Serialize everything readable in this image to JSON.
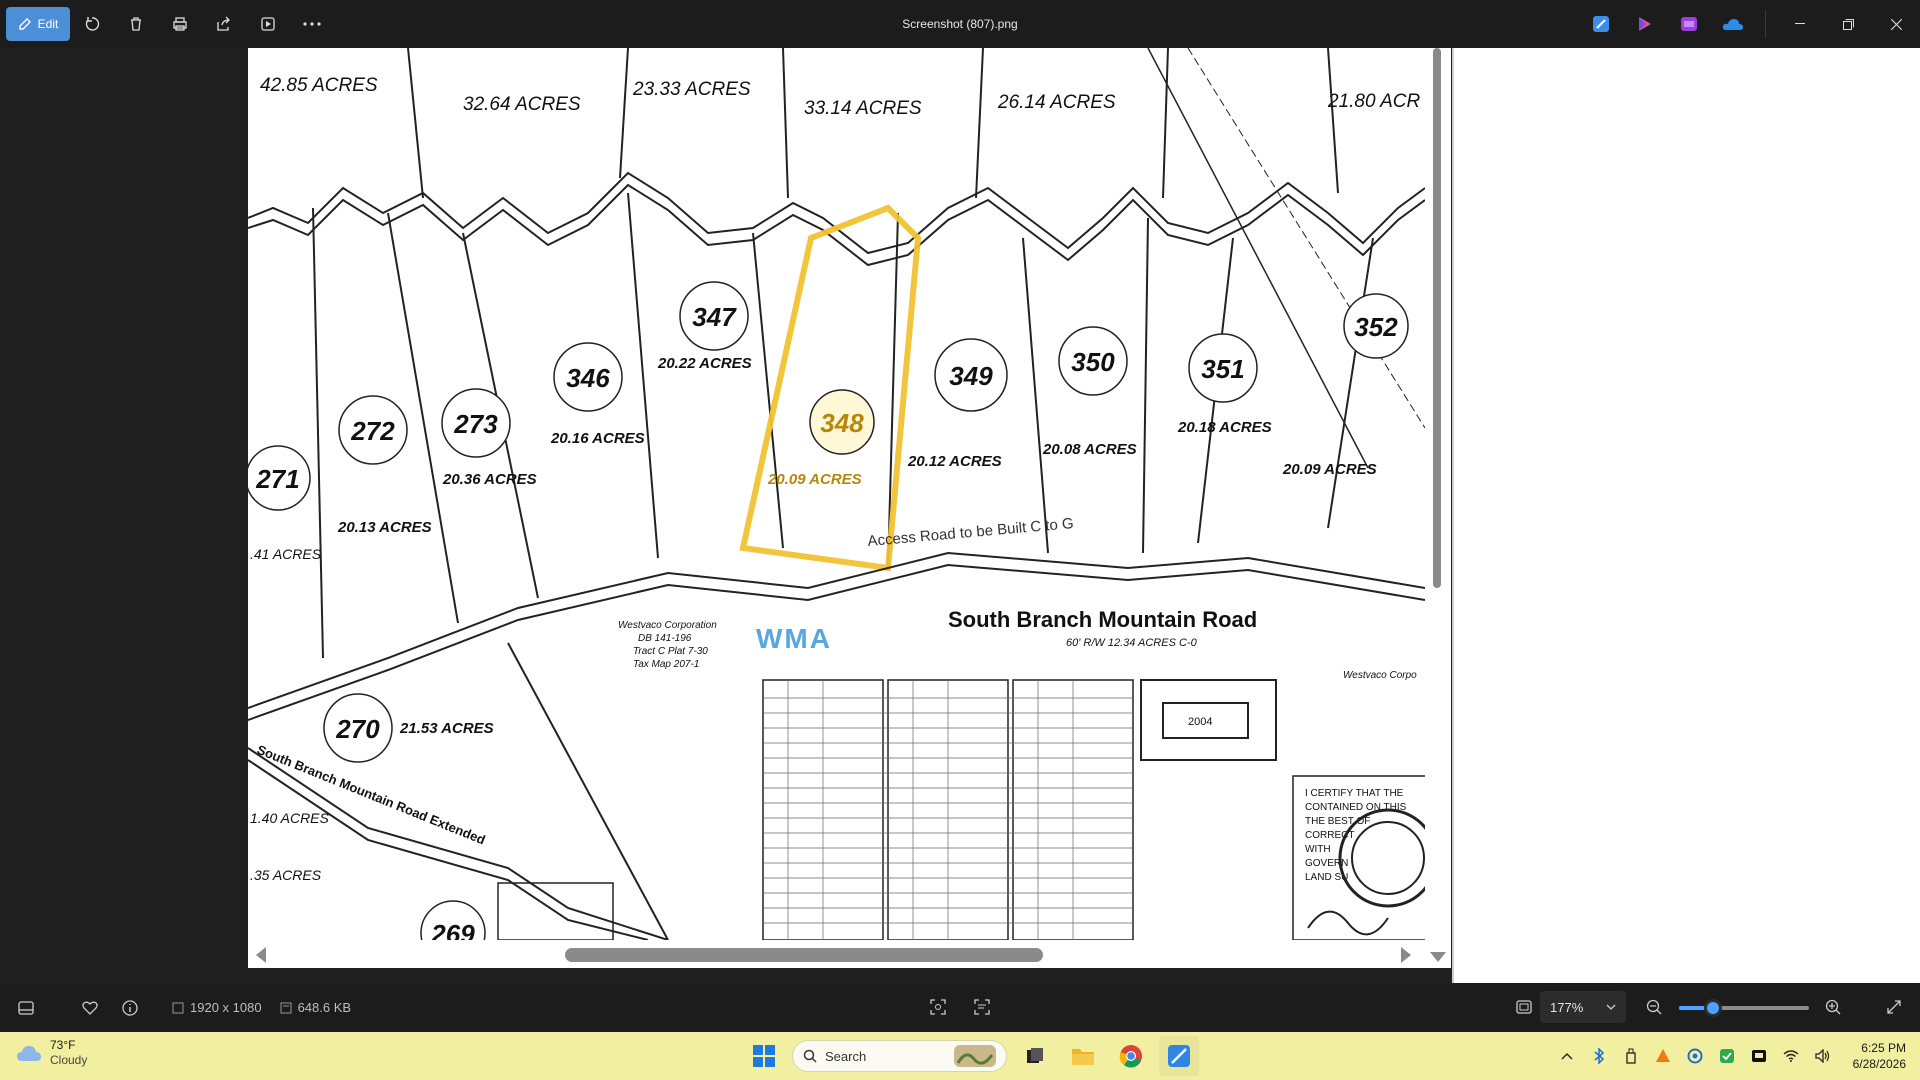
{
  "titlebar": {
    "edit_label": "Edit",
    "file_name": "Screenshot (807).png"
  },
  "map": {
    "parcels": [
      {
        "id": "347",
        "acres": "20.22 ACRES"
      },
      {
        "id": "346",
        "acres": "20.16 ACRES"
      },
      {
        "id": "272",
        "acres": ""
      },
      {
        "id": "273",
        "acres": "20.36 ACRES"
      },
      {
        "id": "271",
        "acres": "20.13 ACRES"
      },
      {
        "id": "348",
        "acres": "20.09 ACRES"
      },
      {
        "id": "349",
        "acres": "20.12 ACRES"
      },
      {
        "id": "350",
        "acres": "20.08 ACRES"
      },
      {
        "id": "351",
        "acres": "20.18 ACRES"
      },
      {
        "id": "352",
        "acres": "20.09 ACRES"
      },
      {
        "id": "270",
        "acres": "21.53 ACRES"
      },
      {
        "id": "269",
        "acres": ""
      }
    ],
    "top_acres": [
      "42.85 ACRES",
      "32.64 ACRES",
      "23.33 ACRES",
      "33.14 ACRES",
      "26.14 ACRES",
      "21.80 ACR"
    ],
    "left_acres": [
      ".41 ACRES",
      "1.40 ACRES",
      ".35 ACRES"
    ],
    "road_main": "South Branch Mountain Road",
    "road_sub": "60' R/W 12.34 ACRES C-0",
    "road_extended": "South Branch Mountain Road Extended",
    "access_road": "Access Road to be Built C to G",
    "wma": "WMA",
    "westvaco": "Westvaco Corporation",
    "westvaco_db": "DB 141-196",
    "westvaco_tract": "Tract C Plat 7-30",
    "westvaco_map": "Tax Map 207-1",
    "westvaco_right": "Westvaco Corpo",
    "stamp_num": "2004",
    "certify_text": "I CERTIFY THAT THE",
    "certify_lines": [
      "CONTAINED ON THIS",
      "THE BEST OF",
      "CORRECT",
      "WITH",
      "GOVERN",
      "LAND SU"
    ]
  },
  "statusbar": {
    "dimensions": "1920 x 1080",
    "file_size": "648.6 KB",
    "zoom": "177%",
    "zoom_level": 0.26
  },
  "taskbar": {
    "temperature": "73°F",
    "condition": "Cloudy",
    "search_placeholder": "Search",
    "time": "6:25 PM",
    "date": "6/28/2026"
  },
  "colors": {
    "accent": "#4c8fd6",
    "highlight": "#f1c232",
    "taskbar": "#f2efa0",
    "wma": "#5aa7e0"
  }
}
